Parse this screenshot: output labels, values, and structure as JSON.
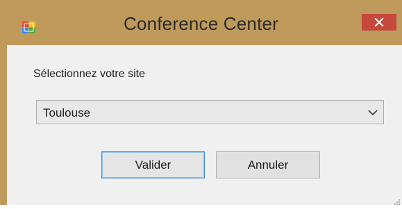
{
  "window": {
    "title": "Conference Center",
    "app_icon": "app-icon",
    "close_icon": "close-icon",
    "colors": {
      "frame": "#c09a5b",
      "close": "#c7483c",
      "client": "#f0f0f0",
      "focus_border": "#3c8ee0"
    }
  },
  "form": {
    "site_label": "Sélectionnez votre site",
    "site_select": {
      "value": "Toulouse",
      "icon": "chevron-down-icon"
    },
    "buttons": {
      "ok": "Valider",
      "cancel": "Annuler"
    }
  }
}
